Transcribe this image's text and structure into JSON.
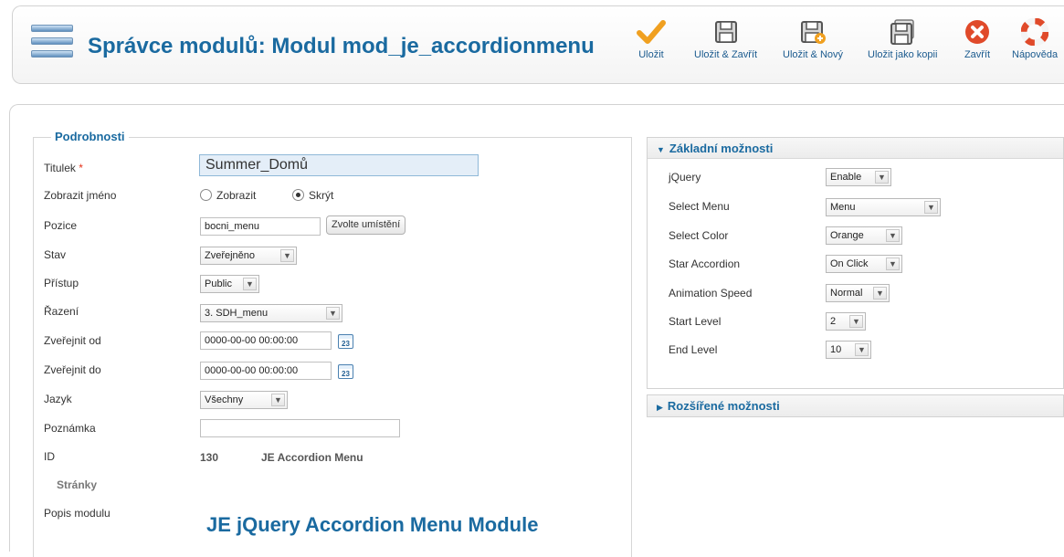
{
  "header": {
    "title": "Správce modulů: Modul mod_je_accordionmenu"
  },
  "toolbar": {
    "save": "Uložit",
    "save_close": "Uložit & Zavřít",
    "save_new": "Uložit & Nový",
    "save_copy": "Uložit jako kopii",
    "close": "Zavřít",
    "help": "Nápověda"
  },
  "details": {
    "legend": "Podrobnosti",
    "title_label": "Titulek",
    "required_mark": "*",
    "title_value": "Summer_Domů",
    "show_title_label": "Zobrazit jméno",
    "show_option": "Zobrazit",
    "hide_option": "Skrýt",
    "show_title_selected": "Skrýt",
    "position_label": "Pozice",
    "position_value": "bocni_menu",
    "position_button": "Zvolte umístění",
    "state_label": "Stav",
    "state_value": "Zveřejněno",
    "access_label": "Přístup",
    "access_value": "Public",
    "ordering_label": "Řazení",
    "ordering_value": "3. SDH_menu",
    "publish_up_label": "Zveřejnit od",
    "publish_up_value": "0000-00-00 00:00:00",
    "publish_down_label": "Zveřejnit do",
    "publish_down_value": "0000-00-00 00:00:00",
    "calendar_day": "23",
    "language_label": "Jazyk",
    "language_value": "Všechny",
    "note_label": "Poznámka",
    "note_value": "",
    "id_label": "ID",
    "id_value": "130",
    "module_name": "JE Accordion Menu",
    "pages_label": "Stránky",
    "description_label": "Popis modulu",
    "description_heading": "JE jQuery Accordion Menu Module"
  },
  "basic_options": {
    "title": "Základní možnosti",
    "jquery_label": "jQuery",
    "jquery_value": "Enable",
    "menu_label": "Select Menu",
    "menu_value": "Menu",
    "color_label": "Select Color",
    "color_value": "Orange",
    "star_label": "Star Accordion",
    "star_value": "On Click",
    "speed_label": "Animation Speed",
    "speed_value": "Normal",
    "start_label": "Start Level",
    "start_value": "2",
    "end_label": "End Level",
    "end_value": "10"
  },
  "advanced_options": {
    "title": "Rozšířené možnosti"
  },
  "colors": {
    "accent": "#1a6aa0",
    "required": "#e5331b",
    "save_check": "#f0a020",
    "close_red": "#e04a2a"
  }
}
